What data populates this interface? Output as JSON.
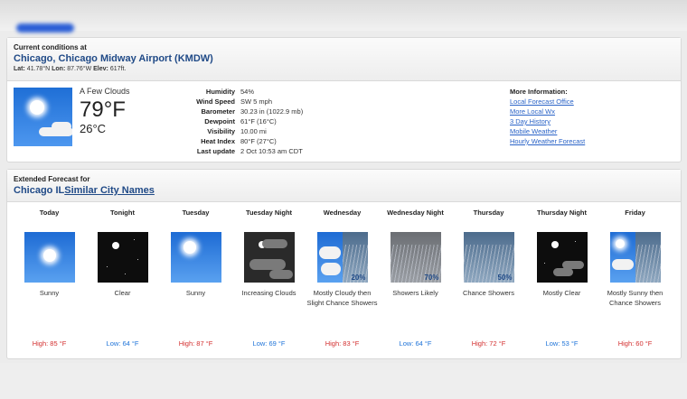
{
  "current": {
    "label": "Current conditions at",
    "station": "Chicago, Chicago Midway Airport (KMDW)",
    "lat_label": "Lat:",
    "lat": "41.78°N",
    "lon_label": "Lon:",
    "lon": "87.76°W",
    "elev_label": "Elev:",
    "elev": "617ft.",
    "summary": "A Few Clouds",
    "temp_f": "79°F",
    "temp_c": "26°C",
    "icon": "sun-few-clouds-icon",
    "details": [
      {
        "label": "Humidity",
        "value": "54%"
      },
      {
        "label": "Wind Speed",
        "value": "SW 5 mph"
      },
      {
        "label": "Barometer",
        "value": "30.23 in (1022.9 mb)"
      },
      {
        "label": "Dewpoint",
        "value": "61°F (16°C)"
      },
      {
        "label": "Visibility",
        "value": "10.00 mi"
      },
      {
        "label": "Heat Index",
        "value": "80°F (27°C)"
      },
      {
        "label": "Last update",
        "value": "2 Oct 10:53 am CDT"
      }
    ],
    "more_info": {
      "heading": "More Information:",
      "links": [
        "Local Forecast Office",
        "More Local Wx",
        "3 Day History",
        "Mobile Weather",
        "Hourly Weather Forecast"
      ]
    }
  },
  "extended": {
    "label": "Extended Forecast for",
    "location": "Chicago IL",
    "similar_link": "Similar City Names",
    "periods": [
      {
        "name": "Today",
        "icon": "sunny-icon",
        "desc": "Sunny",
        "temp": "High: 85 °F",
        "pop": "",
        "kind": "hi"
      },
      {
        "name": "Tonight",
        "icon": "clear-night-icon",
        "desc": "Clear",
        "temp": "Low: 64 °F",
        "pop": "",
        "kind": "lo"
      },
      {
        "name": "Tuesday",
        "icon": "sunny-icon",
        "desc": "Sunny",
        "temp": "High: 87 °F",
        "pop": "",
        "kind": "hi"
      },
      {
        "name": "Tuesday Night",
        "icon": "increasing-clouds-night-icon",
        "desc": "Increasing Clouds",
        "temp": "Low: 69 °F",
        "pop": "",
        "kind": "lo"
      },
      {
        "name": "Wednesday",
        "icon": "mostly-cloudy-showers-icon",
        "desc": "Mostly Cloudy then Slight Chance Showers",
        "temp": "High: 83 °F",
        "pop": "20%",
        "kind": "hi"
      },
      {
        "name": "Wednesday Night",
        "icon": "showers-icon",
        "desc": "Showers Likely",
        "temp": "Low: 64 °F",
        "pop": "70%",
        "kind": "lo"
      },
      {
        "name": "Thursday",
        "icon": "chance-showers-icon",
        "desc": "Chance Showers",
        "temp": "High: 72 °F",
        "pop": "50%",
        "kind": "hi"
      },
      {
        "name": "Thursday Night",
        "icon": "mostly-clear-night-icon",
        "desc": "Mostly Clear",
        "temp": "Low: 53 °F",
        "pop": "",
        "kind": "lo"
      },
      {
        "name": "Friday",
        "icon": "mostly-sunny-showers-icon",
        "desc": "Mostly Sunny then Chance Showers",
        "temp": "High: 60 °F",
        "pop": "",
        "kind": "hi"
      }
    ]
  },
  "colors": {
    "link": "#2a63c7",
    "title": "#204a87",
    "high": "#d32f2f",
    "low": "#1e73d8"
  }
}
